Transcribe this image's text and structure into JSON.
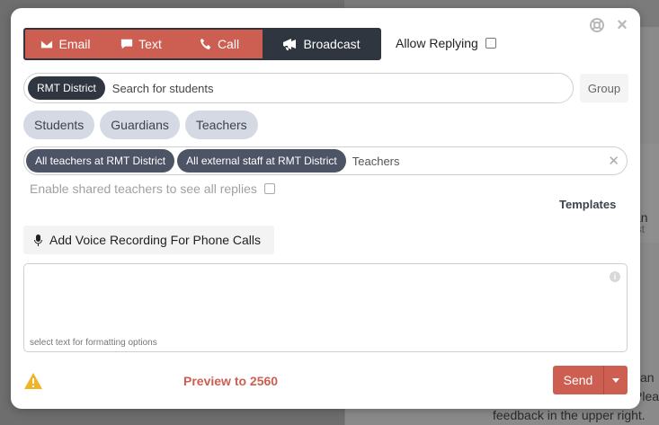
{
  "background": {
    "line1": "an",
    "line2": "ist",
    "line3": "can",
    "line4": "Plea",
    "line5": "feedback in the upper right."
  },
  "modes": [
    {
      "label": "Email",
      "icon": "envelope-icon"
    },
    {
      "label": "Text",
      "icon": "speech-bubble-icon"
    },
    {
      "label": "Call",
      "icon": "phone-icon"
    },
    {
      "label": "Broadcast",
      "icon": "broadcast-icon"
    }
  ],
  "allow_replying": {
    "label": "Allow Replying",
    "checked": false
  },
  "recipients": {
    "chip": "RMT District",
    "placeholder": "Search for students",
    "group_button": "Group"
  },
  "roles": [
    "Students",
    "Guardians",
    "Teachers"
  ],
  "staff": {
    "chips": [
      "All teachers at RMT District",
      "All external staff at RMT District"
    ],
    "placeholder": "Teachers"
  },
  "shared_teachers": {
    "label": "Enable shared teachers to see all replies",
    "checked": false
  },
  "templates_label": "Templates",
  "voice_recording_label": "Add Voice Recording For Phone Calls",
  "editor": {
    "hint": "select text for formatting options"
  },
  "preview_label": "Preview to 2560",
  "send_label": "Send",
  "colors": {
    "accent": "#cd5e52",
    "dark": "#2f3640",
    "chip_slate": "#4d5466",
    "role_tab": "#d4d9e4",
    "warning": "#f0b429"
  }
}
